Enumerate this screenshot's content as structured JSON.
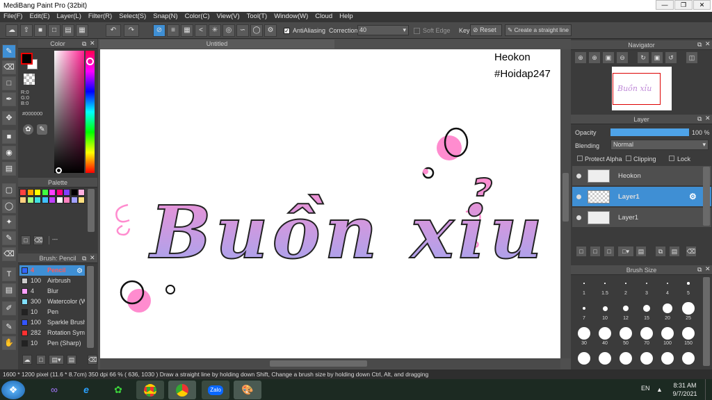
{
  "window": {
    "title": "MediBang Paint Pro (32bit)"
  },
  "menu": [
    "File(F)",
    "Edit(E)",
    "Layer(L)",
    "Filter(R)",
    "Select(S)",
    "Snap(N)",
    "Color(C)",
    "View(V)",
    "Tool(T)",
    "Window(W)",
    "Cloud",
    "Help"
  ],
  "toolbar": {
    "antialiasing": "AntiAliasing",
    "correction_label": "Correction",
    "correction_value": "40",
    "soft_edge": "Soft Edge",
    "key": "Key",
    "reset": "Reset",
    "straight_line": "Create a straight line"
  },
  "color_panel": {
    "title": "Color",
    "r": "R:0",
    "g": "G:0",
    "b": "B:0",
    "hex": "#000000",
    "fg": "#000000",
    "bg": "#ffffff"
  },
  "palette_panel": {
    "title": "Palette",
    "swatches": [
      "#ff4040",
      "#ffa500",
      "#ffff00",
      "#40ff40",
      "#ff40ff",
      "#ff0080",
      "#8040ff",
      "#000000",
      "#ffb0e0",
      "#ffd080",
      "#a0ff80",
      "#40e0e0",
      "#40c0ff",
      "#c040ff",
      "#ffffff",
      "#ff80c0",
      "#a0a0ff",
      "#ffe080"
    ],
    "input_value": "---"
  },
  "brush_panel": {
    "title": "Brush: Pencil",
    "brushes": [
      {
        "size": "4",
        "name": "Pencil",
        "color": "#3366ff",
        "active": true
      },
      {
        "size": "100",
        "name": "Airbrush",
        "color": "#cccccc"
      },
      {
        "size": "4",
        "name": "Blur",
        "color": "#ffa0ff"
      },
      {
        "size": "300",
        "name": "Watercolor (W",
        "color": "#80e0ff"
      },
      {
        "size": "10",
        "name": "Pen",
        "color": "#222222"
      },
      {
        "size": "100",
        "name": "Sparkle Brush",
        "color": "#3355ff"
      },
      {
        "size": "282",
        "name": "Rotation Sym",
        "color": "#ff3030"
      },
      {
        "size": "10",
        "name": "Pen (Sharp)",
        "color": "#222222"
      }
    ]
  },
  "canvas": {
    "tab": "Untitled",
    "watermark_line1": "Heokon",
    "watermark_line2": "#Hoidap247",
    "art_text": "Buồn xỉu"
  },
  "navigator": {
    "title": "Navigator"
  },
  "layer_panel": {
    "title": "Layer",
    "opacity_label": "Opacity",
    "opacity_value": "100 %",
    "opacity_fraction": 1.0,
    "blending_label": "Blending",
    "blending_value": "Normal",
    "protect_alpha": "Protect Alpha",
    "clipping": "Clipping",
    "lock": "Lock",
    "layers": [
      {
        "name": "Heokon"
      },
      {
        "name": "Layer1",
        "active": true
      },
      {
        "name": "Layer1"
      }
    ]
  },
  "brush_size_panel": {
    "title": "Brush Size",
    "sizes": [
      "1",
      "1.5",
      "2",
      "3",
      "4",
      "5",
      "7",
      "10",
      "12",
      "15",
      "20",
      "25",
      "30",
      "40",
      "50",
      "70",
      "100",
      "150",
      "",
      "",
      "",
      "",
      "",
      ""
    ]
  },
  "status": {
    "text": "1600 * 1200 pixel  (11.6 * 8.7cm)  350 dpi  66 %   ( 636, 1030 )  Draw a straight line by holding down Shift, Change a brush size by holding down Ctrl, Alt, and dragging"
  },
  "taskbar": {
    "lang": "EN",
    "time": "8:31 AM",
    "date": "9/7/2021",
    "zalo": "Zalo"
  }
}
